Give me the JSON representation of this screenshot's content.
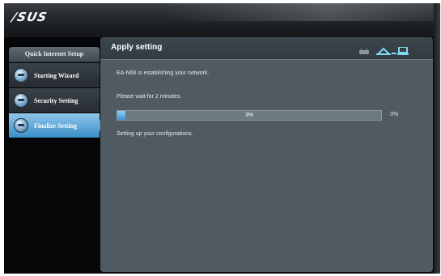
{
  "brand": {
    "logo": "/SUS"
  },
  "sidebar": {
    "header": "Quick Internet Setup",
    "items": [
      {
        "label": "Starting Wizard",
        "icon": "globe-icon",
        "active": false
      },
      {
        "label": "Security Setting",
        "icon": "globe-icon",
        "active": false
      },
      {
        "label": "Finalize Setting",
        "icon": "globe-icon",
        "active": true
      }
    ]
  },
  "panel": {
    "title": "Apply setting",
    "status_icons": [
      "router-icon",
      "wireless-icon",
      "computer-icon"
    ],
    "message": "EA-N66 is establishing your network.",
    "wait_text": "Please wait for 2 minutes.",
    "progress": {
      "percent": 3,
      "label": "3%",
      "side_label": "3%"
    },
    "status_text": "Setting up your configurations."
  },
  "colors": {
    "accent": "#3a8fc8",
    "panel_bg": "#505a61",
    "progress_fill": "#4a9fd8",
    "icon_cyan": "#7ed8ef",
    "icon_green": "#6fbf6a"
  }
}
